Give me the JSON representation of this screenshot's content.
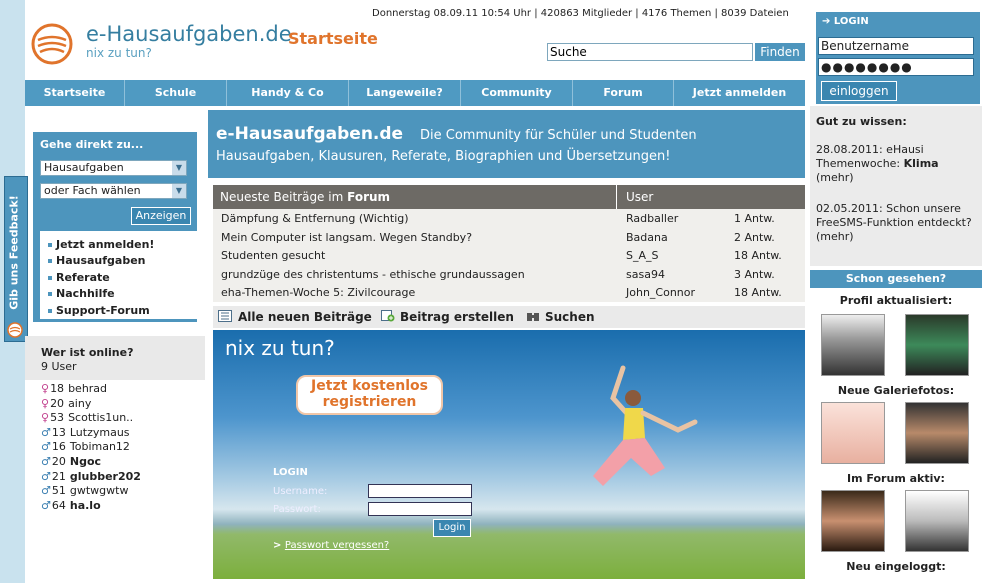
{
  "header": {
    "logo": "e-Hausaufgaben.de",
    "tagline": "nix zu tun?",
    "page_label": "Startseite",
    "info": "Donnerstag 08.09.11 10:54 Uhr | 420863 Mitglieder | 4176 Themen | 8039 Dateien",
    "search_value": "Suche",
    "search_button": "Finden"
  },
  "nav": [
    "Startseite",
    "Schule",
    "Handy & Co",
    "Langeweile?",
    "Community",
    "Forum",
    "Jetzt anmelden"
  ],
  "sidebar": {
    "gehe_title": "Gehe direkt zu...",
    "select1": "Hausaufgaben",
    "select2": "oder Fach wählen",
    "anzeigen": "Anzeigen",
    "links": [
      "Jetzt anmelden!",
      "Hausaufgaben",
      "Referate",
      "Nachhilfe",
      "Support-Forum"
    ],
    "online_title": "Wer ist online?",
    "online_count": "9 User",
    "users": [
      {
        "sym": "♀",
        "age": "18",
        "name": "behrad",
        "g": "f",
        "bold": false
      },
      {
        "sym": "♀",
        "age": "20",
        "name": "ainy",
        "g": "f",
        "bold": false
      },
      {
        "sym": "♀",
        "age": "53",
        "name": "Scottis1un..",
        "g": "f",
        "bold": false
      },
      {
        "sym": "♂",
        "age": "13",
        "name": "Lutzymaus",
        "g": "m",
        "bold": false
      },
      {
        "sym": "♂",
        "age": "16",
        "name": "Tobiman12",
        "g": "m",
        "bold": false
      },
      {
        "sym": "♂",
        "age": "20",
        "name": "Ngoc",
        "g": "m",
        "bold": true
      },
      {
        "sym": "♂",
        "age": "21",
        "name": "glubber202",
        "g": "m",
        "bold": true
      },
      {
        "sym": "♂",
        "age": "51",
        "name": "gwtwgwtw",
        "g": "m",
        "bold": false
      },
      {
        "sym": "♂",
        "age": "64",
        "name": "ha.lo",
        "g": "m",
        "bold": true
      }
    ],
    "feedback": "Gib uns Feedback!"
  },
  "hero": {
    "title": "e-Hausaufgaben.de",
    "tag": "Die Community für Schüler und Studenten",
    "line2": "Hausaufgaben, Klausuren, Referate, Biographien und Übersetzungen!"
  },
  "posts": {
    "head_prefix": "Neueste Beiträge im ",
    "head_bold": "Forum",
    "head_user": "User",
    "rows": [
      {
        "title": "Dämpfung & Entfernung (Wichtig)",
        "user": "Radballer",
        "answers": "1 Antw."
      },
      {
        "title": "Mein Computer ist langsam. Wegen Standby?",
        "user": "Badana",
        "answers": "2 Antw."
      },
      {
        "title": "Studenten gesucht",
        "user": "S_A_S",
        "answers": "18 Antw."
      },
      {
        "title": "grundzüge des christentums - ethische grundaussagen",
        "user": "sasa94",
        "answers": "3 Antw."
      },
      {
        "title": "eha-Themen-Woche 5: Zivilcourage",
        "user": "John_Connor",
        "answers": "18 Antw."
      }
    ],
    "actions": [
      "Alle neuen Beiträge",
      "Beitrag erstellen",
      "Suchen"
    ]
  },
  "promo": {
    "title": "nix zu tun?",
    "cta1": "Jetzt kostenlos",
    "cta2": "registrieren",
    "login": "LOGIN",
    "username": "Username:",
    "password": "Passwort:",
    "login_button": "Login",
    "pw_prefix": "> ",
    "pw_link": "Passwort vergessen?"
  },
  "right": {
    "login_title": "LOGIN",
    "user_value": "Benutzername",
    "pass_value": "●●●●●●●●",
    "login_button": "einloggen",
    "gut_title": "Gut zu wissen:",
    "news1": {
      "prefix": "28.08.2011: eHausi Themenwoche: ",
      "bold": "Klima",
      "suffix": " (mehr)"
    },
    "news2": "02.05.2011: Schon unsere FreeSMS-Funktion entdeckt? (mehr)",
    "schon": "Schon gesehen?",
    "sections": [
      "Profil aktualisiert:",
      "Neue Galeriefotos:",
      "Im Forum aktiv:",
      "Neu eingeloggt:"
    ]
  },
  "colors": {
    "accent": "#4d95bd",
    "orange": "#e0742c"
  }
}
